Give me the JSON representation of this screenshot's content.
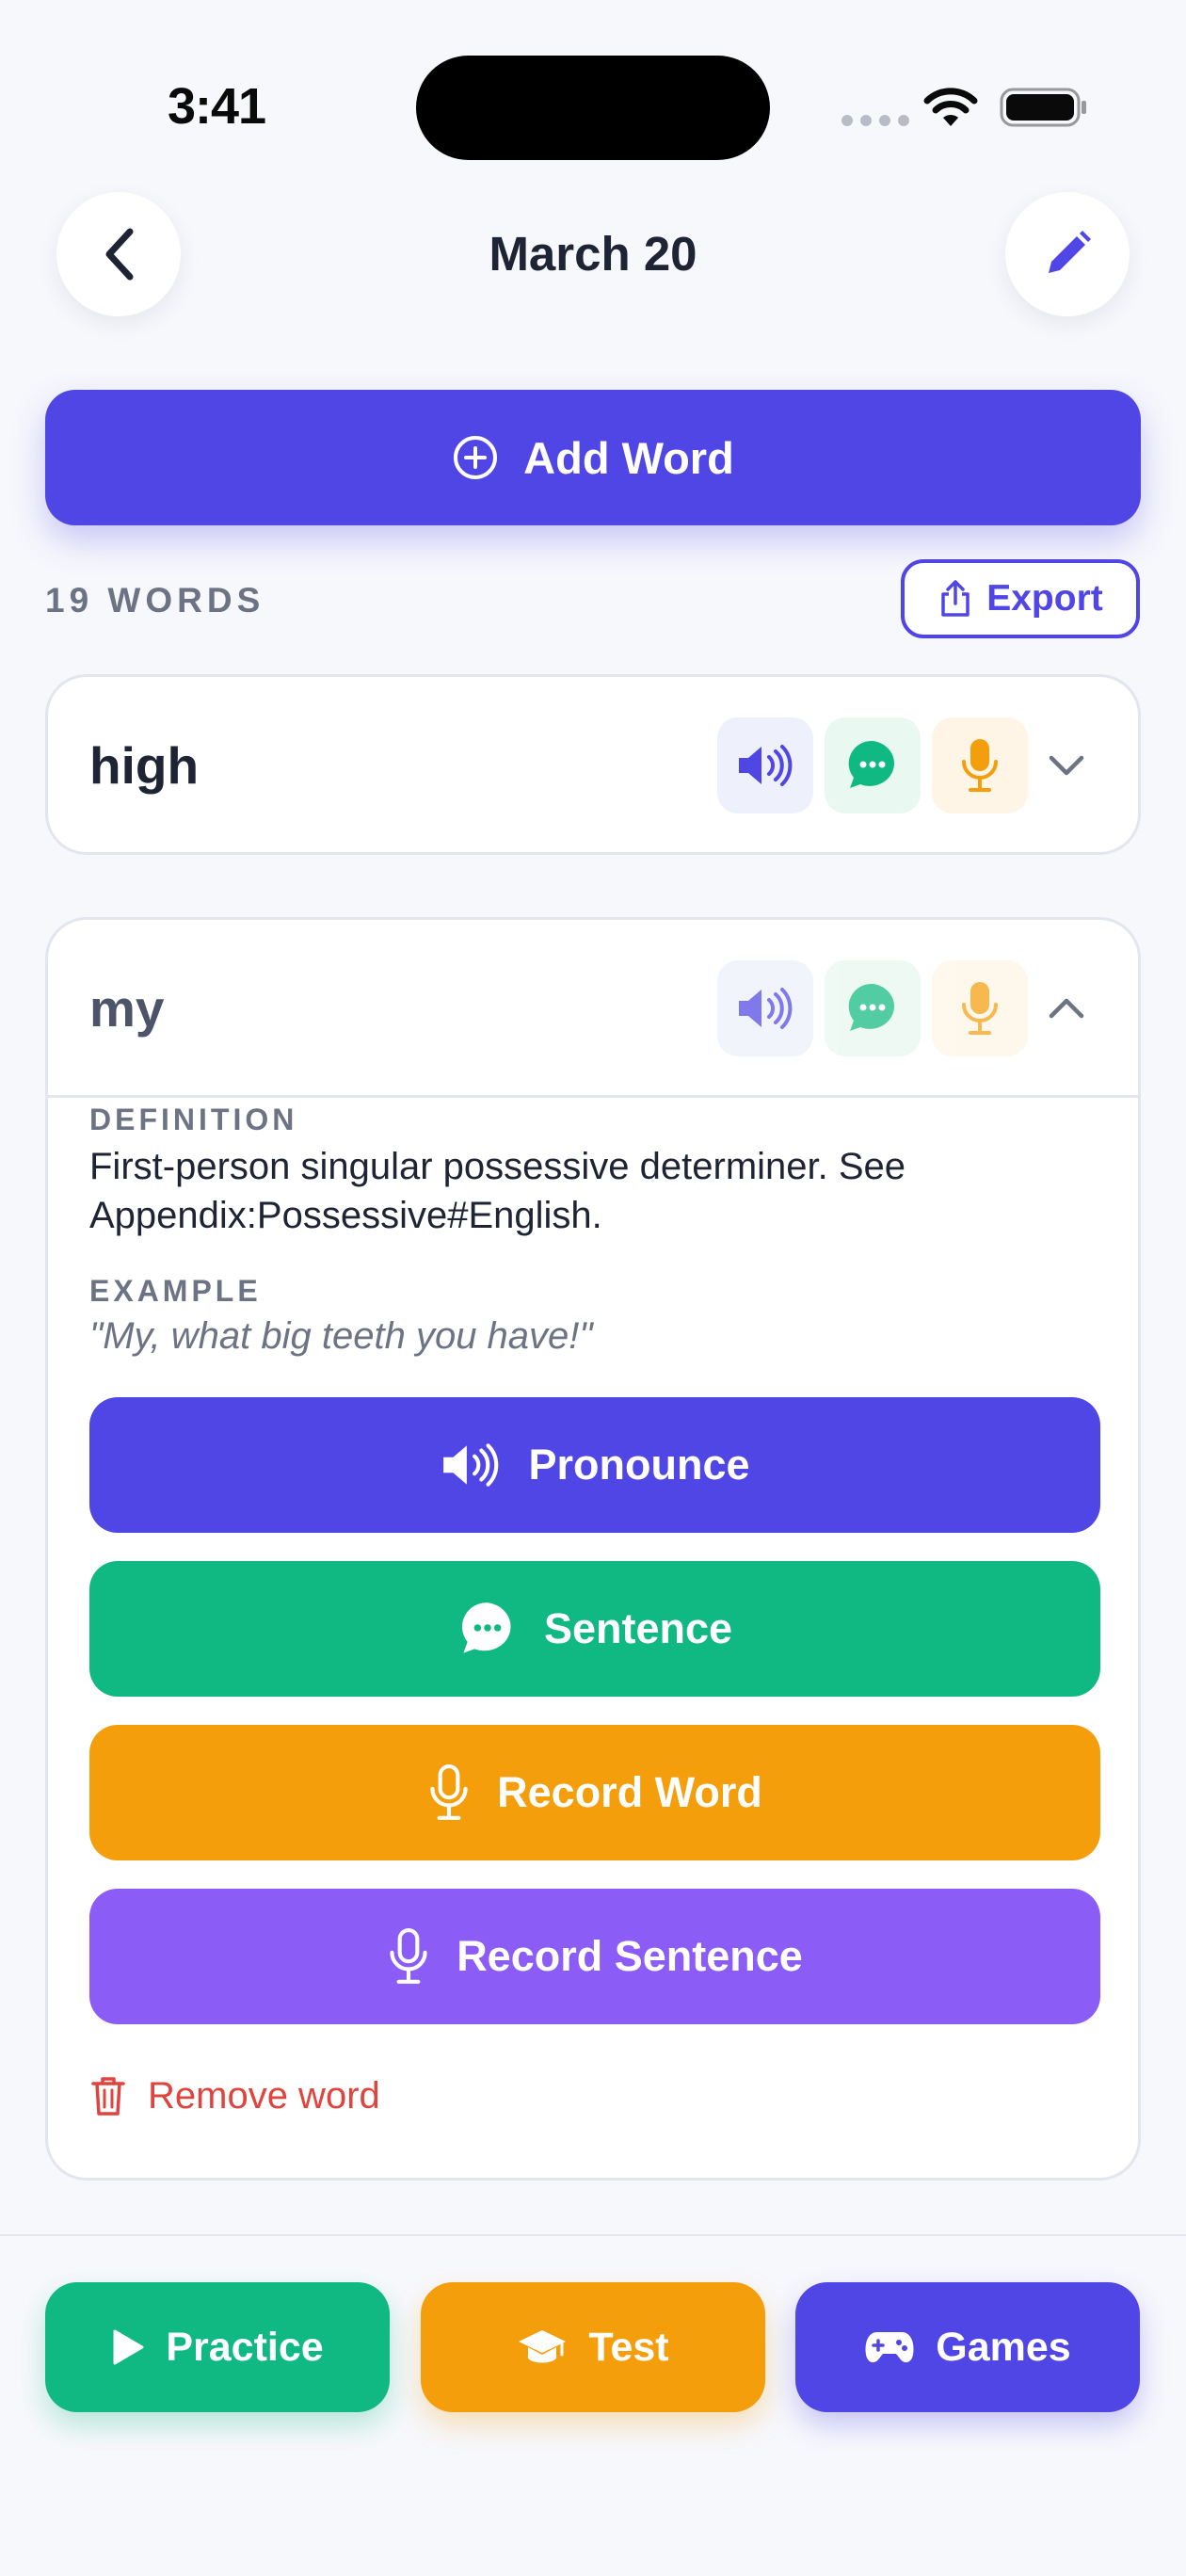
{
  "status_bar": {
    "time": "3:41"
  },
  "header": {
    "title": "March 20",
    "back_icon": "chevron-left-icon",
    "edit_icon": "pencil-icon"
  },
  "add_word": {
    "label": "Add Word",
    "icon": "plus-circle-icon"
  },
  "list_header": {
    "count_label": "19 WORDS",
    "export_label": "Export"
  },
  "words": [
    {
      "word": "high",
      "expanded": false
    },
    {
      "word": "my",
      "expanded": true,
      "definition_label": "DEFINITION",
      "definition": "First-person singular possessive determiner. See Appendix:Possessive#English.",
      "example_label": "EXAMPLE",
      "example": "\"My, what big teeth you have!\"",
      "actions": {
        "pronounce": "Pronounce",
        "sentence": "Sentence",
        "record_word": "Record Word",
        "record_sentence": "Record Sentence"
      },
      "remove_label": "Remove word"
    }
  ],
  "bottom_tabs": {
    "practice": "Practice",
    "test": "Test",
    "games": "Games"
  },
  "colors": {
    "primary": "#4f46e5",
    "green": "#10b981",
    "orange": "#f59e0b",
    "purple": "#8b5cf6",
    "danger": "#e0443e",
    "background": "#f7f8fc"
  }
}
